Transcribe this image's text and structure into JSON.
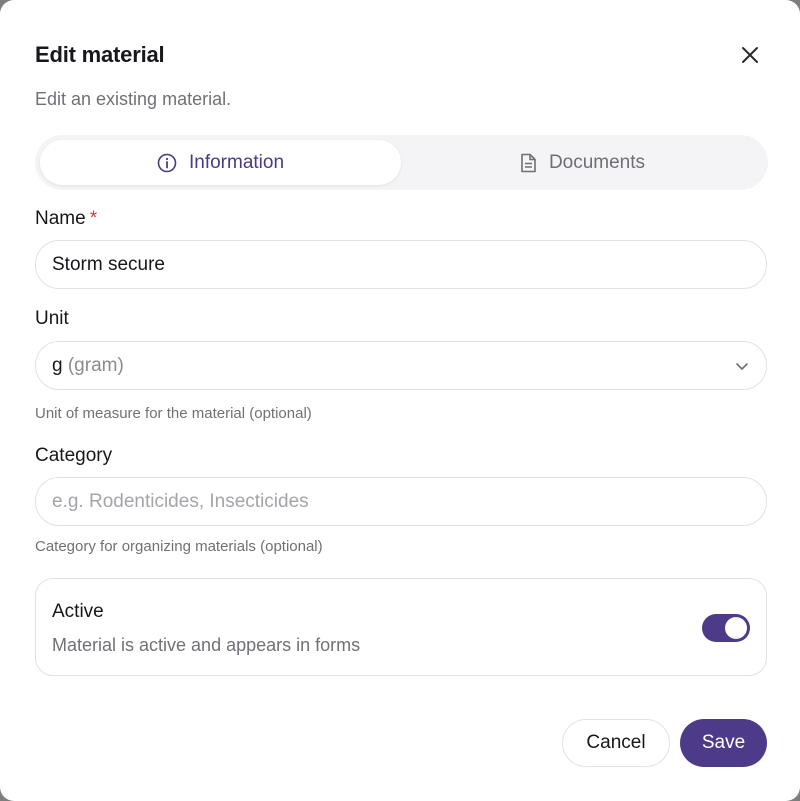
{
  "dialog": {
    "title": "Edit material",
    "subtitle": "Edit an existing material."
  },
  "tabs": [
    {
      "label": "Information",
      "icon": "info-circle-icon",
      "active": true
    },
    {
      "label": "Documents",
      "icon": "document-icon",
      "active": false
    }
  ],
  "form": {
    "name": {
      "label": "Name",
      "required_mark": "*",
      "value": "Storm secure"
    },
    "unit": {
      "label": "Unit",
      "value_code": "g",
      "value_name": "(gram)",
      "hint": "Unit of measure for the material (optional)"
    },
    "category": {
      "label": "Category",
      "value": "",
      "placeholder": "e.g. Rodenticides, Insecticides",
      "hint": "Category for organizing materials (optional)"
    },
    "active": {
      "title": "Active",
      "description": "Material is active and appears in forms",
      "enabled": true
    }
  },
  "actions": {
    "cancel_label": "Cancel",
    "save_label": "Save"
  },
  "colors": {
    "accent": "#4d3b8a",
    "required": "#d43a3a"
  }
}
